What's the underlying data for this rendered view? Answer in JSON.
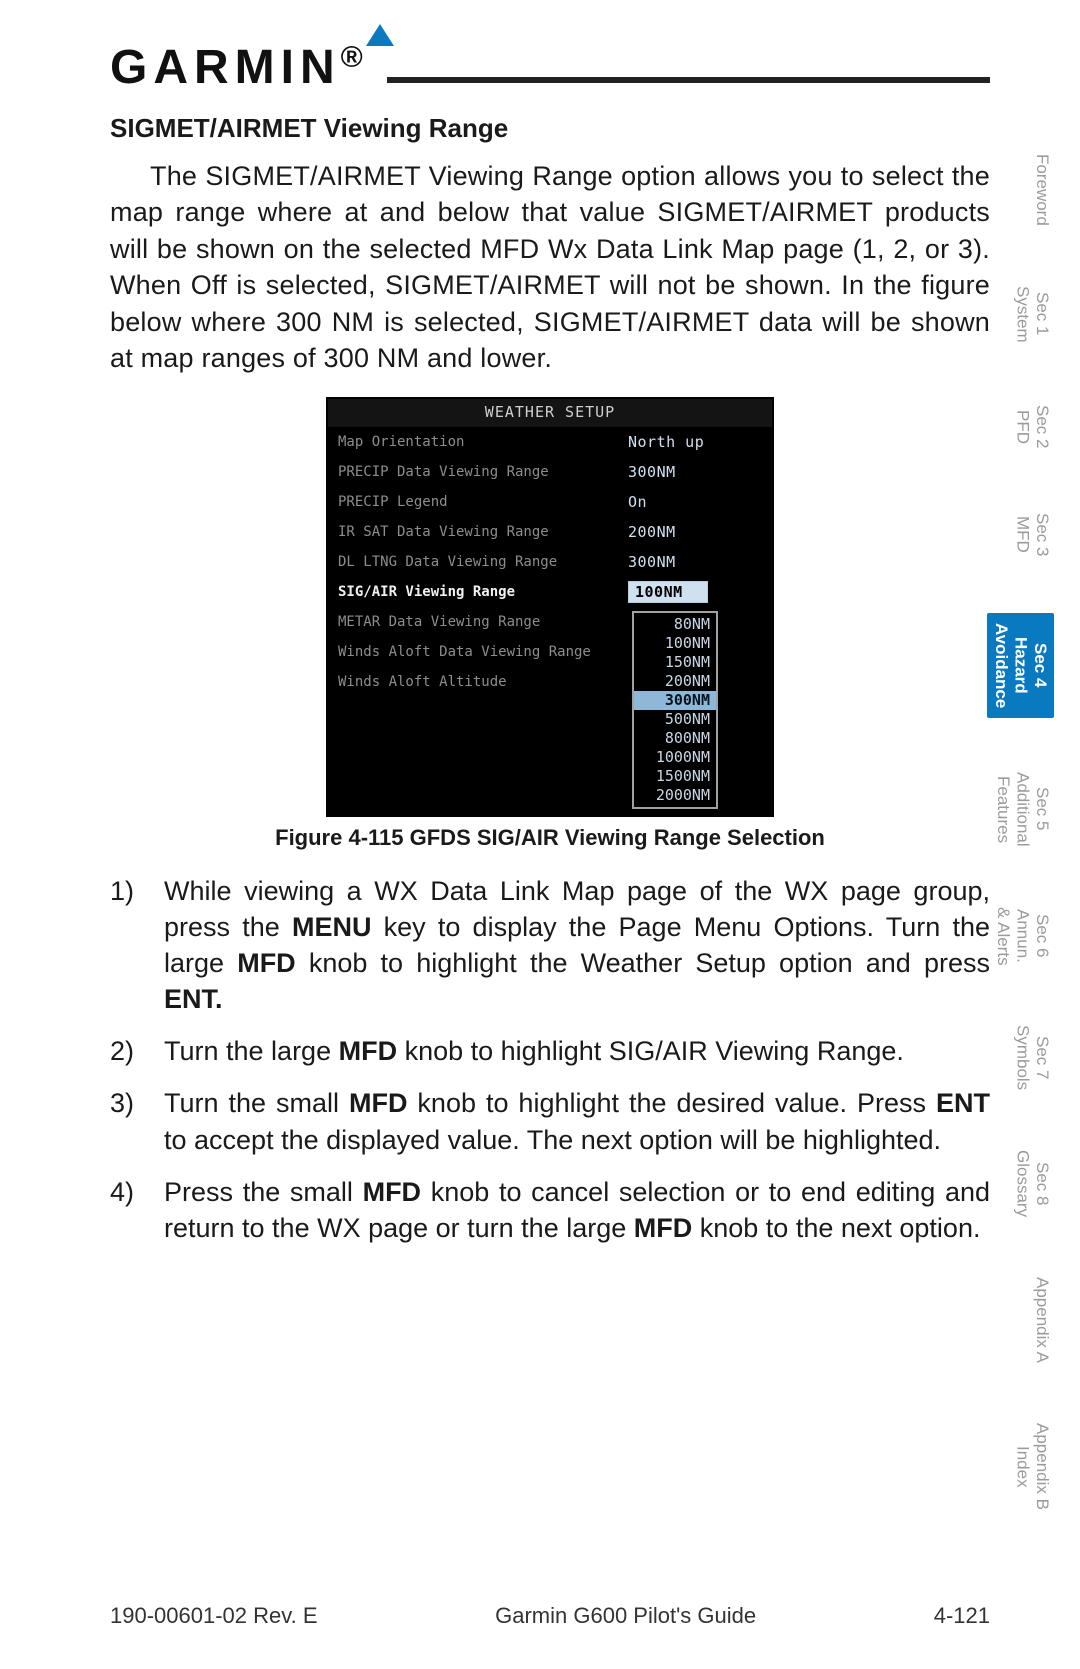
{
  "logo": {
    "text": "GARMIN"
  },
  "heading": "SIGMET/AIRMET Viewing Range",
  "paragraph": "The SIGMET/AIRMET Viewing Range option allows you to select the map range where at and below that value SIGMET/AIRMET products will be shown on the selected MFD Wx Data Link Map page (1, 2, or 3). When Off is selected, SIGMET/AIRMET will not be shown. In the figure below where 300 NM is selected, SIGMET/AIRMET data will be shown at map ranges of 300 NM and lower.",
  "device": {
    "title": "WEATHER SETUP",
    "rows": [
      {
        "label": "Map Orientation",
        "value": "North up",
        "highlight": false
      },
      {
        "label": "PRECIP Data Viewing Range",
        "value": "300NM",
        "highlight": false
      },
      {
        "label": "PRECIP Legend",
        "value": "On",
        "highlight": false
      },
      {
        "label": "IR SAT Data Viewing Range",
        "value": "200NM",
        "highlight": false
      },
      {
        "label": "DL LTNG Data Viewing Range",
        "value": "300NM",
        "highlight": false
      },
      {
        "label": "SIG/AIR Viewing Range",
        "value": "100NM",
        "highlight": true
      },
      {
        "label": "METAR Data Viewing Range",
        "value": "",
        "highlight": false
      },
      {
        "label": "Winds Aloft Data Viewing Range",
        "value": "",
        "highlight": false
      },
      {
        "label": "Winds Aloft Altitude",
        "value": "",
        "highlight": false
      }
    ],
    "dropdown": {
      "options": [
        "80NM",
        "100NM",
        "150NM",
        "200NM",
        "300NM",
        "500NM",
        "800NM",
        "1000NM",
        "1500NM",
        "2000NM"
      ],
      "selected": "300NM"
    }
  },
  "figure_caption": "Figure 4-115  GFDS SIG/AIR Viewing Range Selection",
  "steps": [
    {
      "num": "1)",
      "html": "While viewing a WX Data Link Map page of the WX page group, press the <b>MENU</b> key to display the Page Menu Options. Turn the large <b>MFD</b> knob to highlight the Weather Setup option and press <b>ENT.</b>"
    },
    {
      "num": "2)",
      "html": "Turn the large <b>MFD</b> knob to highlight SIG/AIR Viewing Range."
    },
    {
      "num": "3)",
      "html": "Turn the small <b>MFD</b> knob to highlight the desired value. Press <b>ENT</b> to accept the displayed value. The next option will be highlighted."
    },
    {
      "num": "4)",
      "html": "Press the small <b>MFD</b> knob to cancel selection or to end editing and return to the WX page or turn the large <b>MFD</b> knob to the next option."
    }
  ],
  "sidetabs": [
    {
      "label": "Foreword",
      "active": false
    },
    {
      "label": "Sec 1\nSystem",
      "active": false
    },
    {
      "label": "Sec 2\nPFD",
      "active": false
    },
    {
      "label": "Sec 3\nMFD",
      "active": false
    },
    {
      "label": "Sec 4\nHazard\nAvoidance",
      "active": true
    },
    {
      "label": "Sec 5\nAdditional\nFeatures",
      "active": false
    },
    {
      "label": "Sec 6\nAnnun.\n& Alerts",
      "active": false
    },
    {
      "label": "Sec 7\nSymbols",
      "active": false
    },
    {
      "label": "Sec 8\nGlossary",
      "active": false
    },
    {
      "label": "Appendix A",
      "active": false
    },
    {
      "label": "Appendix B\nIndex",
      "active": false
    }
  ],
  "footer": {
    "left": "190-00601-02  Rev. E",
    "center": "Garmin G600 Pilot's Guide",
    "right": "4-121"
  }
}
